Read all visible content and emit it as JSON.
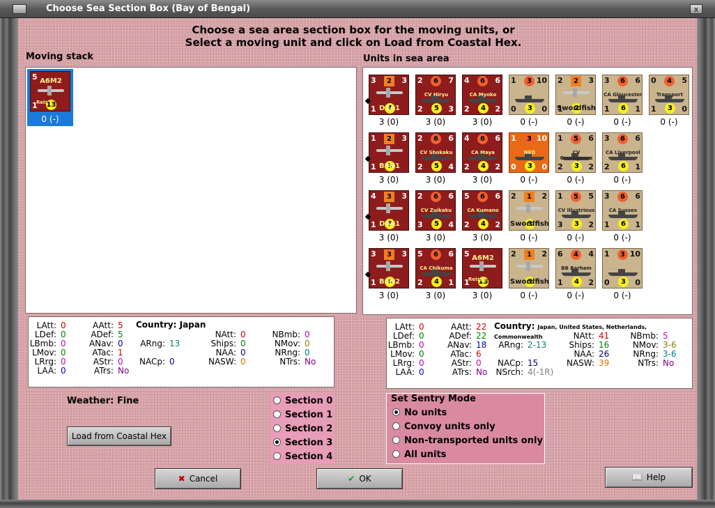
{
  "window": {
    "title": "Choose Sea Section Box (Bay of Bengal)",
    "close_label": "x"
  },
  "heading": {
    "line1": "Choose a sea area section box for the moving units, or",
    "line2": "Select a moving unit and click on Load from Coastal Hex."
  },
  "moving_stack": {
    "label": "Moving stack",
    "counter": {
      "tl": "5",
      "name": "A6M2",
      "sub": "Reisen",
      "bl": "1",
      "yc": "13",
      "caption": "0 (-)"
    }
  },
  "units_area": {
    "label": "Units in sea area",
    "units": [
      {
        "tl": "3",
        "sq": "2",
        "tr": "3",
        "name": "D3A1",
        "bl": "1",
        "yc": "4",
        "caption": "3 (0)",
        "style": "red"
      },
      {
        "tl": "2",
        "circ": "6",
        "tr": "7",
        "name": "CV Hiryu",
        "bl": "2",
        "yc": "5",
        "br": "3",
        "caption": "3 (0)",
        "style": "red"
      },
      {
        "tl": "4",
        "circ": "6",
        "tr": "6",
        "name": "CA Myoko",
        "bl": "2",
        "yc": "4",
        "br": "2",
        "caption": "3 (0)",
        "style": "red"
      },
      {
        "tl": "1",
        "circ": "3",
        "tr": "10",
        "name": "",
        "bl": "0",
        "yc": "3",
        "br": "0",
        "caption": "0 (-)",
        "style": "tan"
      },
      {
        "tl": "2",
        "sq": "2",
        "tr": "3",
        "name": "Swordfish",
        "bl": "1",
        "yc": "2",
        "caption": "0 (-)",
        "style": "tan"
      },
      {
        "tl": "3",
        "circ": "6",
        "tr": "6",
        "name": "CA Gloucester",
        "bl": "1",
        "yc": "6",
        "br": "1",
        "caption": "0 (-)",
        "style": "tan"
      },
      {
        "tl": "0",
        "circ": "4",
        "tr": "5",
        "name": "Transport",
        "bl": "1",
        "yc": "3",
        "br": "0",
        "caption": "0 (-)",
        "style": "tan"
      },
      {
        "tl": "1",
        "sq": "2",
        "tr": "3",
        "name": "B5N1",
        "bl": "1",
        "yc": "3",
        "caption": "3 (0)",
        "style": "red"
      },
      {
        "tl": "2",
        "circ": "6",
        "tr": "6",
        "name": "CV Shokaku",
        "bl": "2",
        "yc": "5",
        "br": "4",
        "caption": "3 (0)",
        "style": "red"
      },
      {
        "tl": "4",
        "circ": "6",
        "tr": "6",
        "name": "CA Maya",
        "bl": "2",
        "yc": "4",
        "br": "2",
        "caption": "3 (0)",
        "style": "red"
      },
      {
        "tl": "1",
        "circ": "3",
        "tr": "10",
        "name": "NED",
        "bl": "0",
        "yc": "3",
        "br": "0",
        "caption": "0 (-)",
        "style": "orange"
      },
      {
        "tl": "1",
        "circ": "5",
        "tr": "6",
        "name": "CV Courageous",
        "bl": "2",
        "yc": "3",
        "br": "2",
        "caption": "0 (-)",
        "style": "tan"
      },
      {
        "tl": "3",
        "circ": "6",
        "tr": "6",
        "name": "CA Liverpool",
        "bl": "2",
        "yc": "6",
        "br": "1",
        "caption": "0 (-)",
        "style": "tan"
      },
      {
        "tl": "4",
        "sq": "3",
        "tr": "3",
        "name": "D3A1",
        "bl": "1",
        "yc": "5",
        "caption": "3 (0)",
        "style": "red"
      },
      {
        "tl": "2",
        "circ": "6",
        "tr": "6",
        "name": "CV Zuikaku",
        "bl": "3",
        "yc": "5",
        "br": "4",
        "caption": "3 (0)",
        "style": "red"
      },
      {
        "tl": "5",
        "circ": "6",
        "tr": "6",
        "name": "CA Kumano",
        "bl": "2",
        "yc": "4",
        "br": "2",
        "caption": "3 (0)",
        "style": "red"
      },
      {
        "tl": "2",
        "sq": "1",
        "tr": "2",
        "name": "Swordfish",
        "bl": "",
        "yc": "3",
        "caption": "0 (-)",
        "style": "tan"
      },
      {
        "tl": "1",
        "circ": "5",
        "tr": "5",
        "name": "CV Illustrious",
        "bl": "3",
        "yc": "3",
        "br": "2",
        "caption": "0 (-)",
        "style": "tan"
      },
      {
        "tl": "3",
        "circ": "6",
        "tr": "6",
        "name": "CA Sussex",
        "bl": "1",
        "yc": "6",
        "br": "1",
        "caption": "0 (-)",
        "style": "tan"
      },
      {
        "tl": "3",
        "sq": "3",
        "tr": "3",
        "name": "B5N2",
        "bl": "1",
        "yc": "4",
        "caption": "3 (0)",
        "style": "red"
      },
      {
        "tl": "5",
        "circ": "6",
        "tr": "6",
        "name": "CA Chikuma",
        "bl": "2",
        "yc": "4",
        "br": "1",
        "caption": "3 (0)",
        "style": "red"
      },
      {
        "tl": "5",
        "circ": "",
        "tr": "",
        "name": "A6M2",
        "bl": "1",
        "yc": "13",
        "br": "",
        "caption": "3 (0)",
        "style": "red",
        "sub": "Reisen"
      },
      {
        "tl": "2",
        "sq": "1",
        "tr": "2",
        "name": "Swordfish",
        "bl": "",
        "yc": "3",
        "caption": "0 (-)",
        "style": "tan"
      },
      {
        "tl": "6",
        "circ": "4",
        "tr": "4",
        "name": "BB Barham",
        "bl": "1",
        "yc": "4",
        "br": "2",
        "caption": "0 (-)",
        "style": "tan"
      },
      {
        "tl": "1",
        "circ": "3",
        "tr": "10",
        "name": "",
        "bl": "0",
        "yc": "3",
        "br": "0",
        "caption": "0 (-)",
        "style": "tan"
      }
    ]
  },
  "left_stats": {
    "country_label": "Country:",
    "country": "Japan",
    "items": [
      {
        "k": "LAtt:",
        "v": "0"
      },
      {
        "k": "LDef:",
        "v": "0"
      },
      {
        "k": "LBmb:",
        "v": "0"
      },
      {
        "k": "LMov:",
        "v": "0"
      },
      {
        "k": "LRrg:",
        "v": "0"
      },
      {
        "k": "LAA:",
        "v": "0"
      },
      {
        "k": "AAtt:",
        "v": "5"
      },
      {
        "k": "ADef:",
        "v": "5"
      },
      {
        "k": "ANav:",
        "v": "0"
      },
      {
        "k": "ATac:",
        "v": "1"
      },
      {
        "k": "AStr:",
        "v": "0"
      },
      {
        "k": "ATrs:",
        "v": "No"
      },
      {
        "k": "ARng:",
        "v": "13"
      },
      {
        "k": "NACp:",
        "v": "0"
      },
      {
        "k": "NAtt:",
        "v": "0"
      },
      {
        "k": "Ships:",
        "v": "0"
      },
      {
        "k": "NAA:",
        "v": "0"
      },
      {
        "k": "NASW:",
        "v": "0"
      },
      {
        "k": "NBmb:",
        "v": "0"
      },
      {
        "k": "NMov:",
        "v": "0"
      },
      {
        "k": "NRng:",
        "v": "0"
      },
      {
        "k": "NTrs:",
        "v": "No"
      }
    ]
  },
  "right_stats": {
    "country_label": "Country:",
    "country": "Japan, United States, Netherlands, Commonwealth",
    "items": [
      {
        "k": "LAtt:",
        "v": "0"
      },
      {
        "k": "LDef:",
        "v": "0"
      },
      {
        "k": "LBmb:",
        "v": "0"
      },
      {
        "k": "LMov:",
        "v": "0"
      },
      {
        "k": "LRrg:",
        "v": "0"
      },
      {
        "k": "LAA:",
        "v": "0"
      },
      {
        "k": "AAtt:",
        "v": "22"
      },
      {
        "k": "ADef:",
        "v": "22"
      },
      {
        "k": "ANav:",
        "v": "18"
      },
      {
        "k": "ATac:",
        "v": "6"
      },
      {
        "k": "AStr:",
        "v": "0"
      },
      {
        "k": "ATrs:",
        "v": "No"
      },
      {
        "k": "ARng:",
        "v": "2-13"
      },
      {
        "k": "NACp:",
        "v": "15"
      },
      {
        "k": "NSrch:",
        "v": "4(-1R)"
      },
      {
        "k": "NAtt:",
        "v": "41"
      },
      {
        "k": "Ships:",
        "v": "16"
      },
      {
        "k": "NAA:",
        "v": "26"
      },
      {
        "k": "NASW:",
        "v": "39"
      },
      {
        "k": "NBmb:",
        "v": "5"
      },
      {
        "k": "NMov:",
        "v": "3-6"
      },
      {
        "k": "NRng:",
        "v": "3-6"
      },
      {
        "k": "NTrs:",
        "v": "No"
      }
    ]
  },
  "weather": "Weather: Fine",
  "buttons": {
    "load": "Load from Coastal Hex",
    "cancel": "Cancel",
    "ok": "OK",
    "help": "Help"
  },
  "sections": {
    "options": [
      "Section 0",
      "Section 1",
      "Section 2",
      "Section 3",
      "Section 4"
    ],
    "selected": 3
  },
  "sentry": {
    "legend": "Set Sentry Mode",
    "options": [
      "No units",
      "Convoy units only",
      "Non-transported units only",
      "All units"
    ],
    "selected": 0
  }
}
